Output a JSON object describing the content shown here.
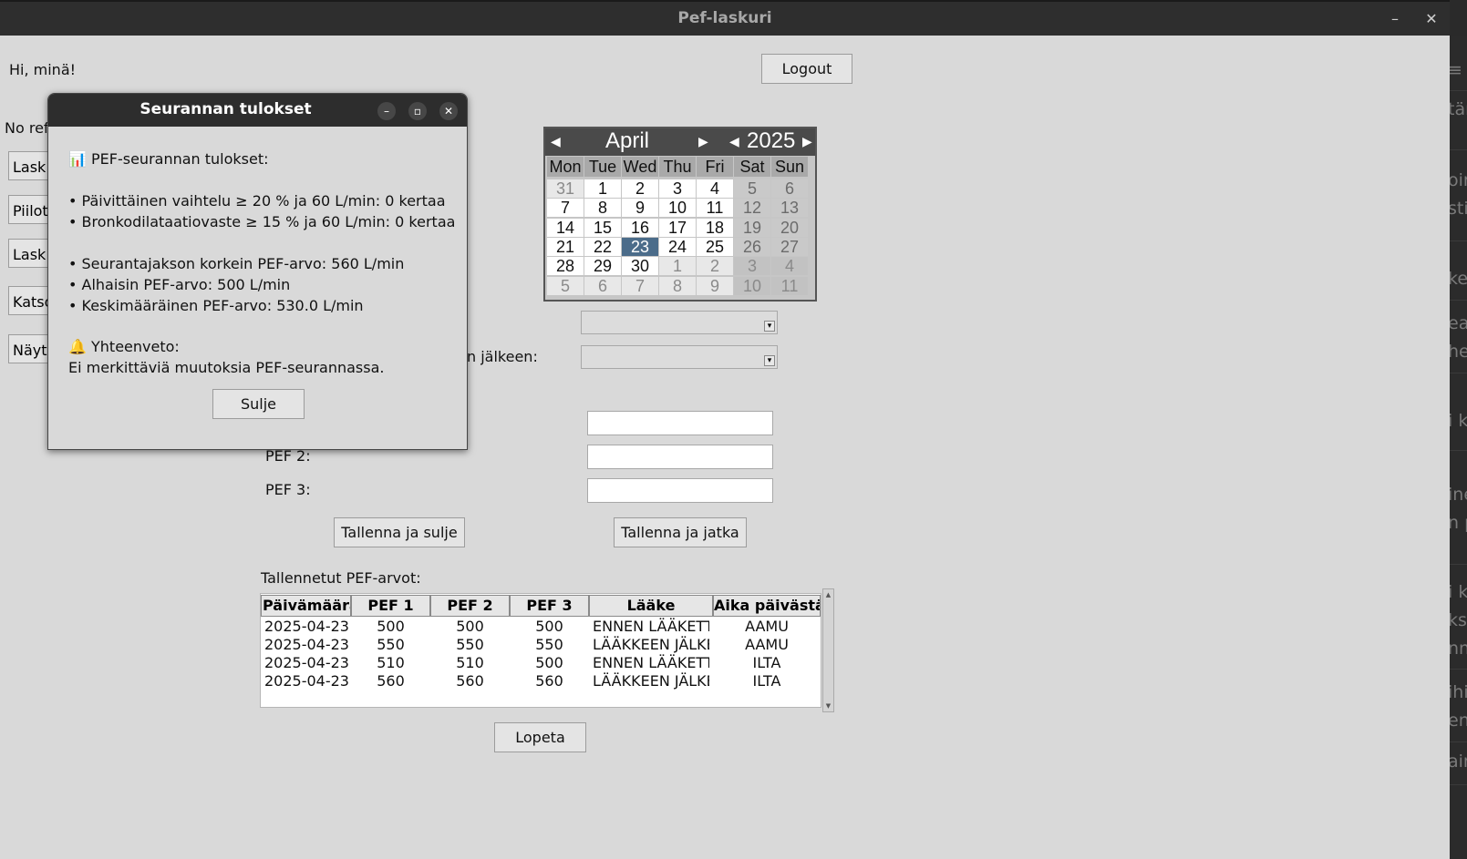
{
  "window": {
    "title": "Pef-laskuri",
    "minimize_glyph": "–",
    "close_glyph": "✕"
  },
  "main": {
    "greeting": "Hi, minä!",
    "logout": "Logout",
    "no_ref": "No ref",
    "side_buttons": [
      "Lask",
      "Piilot",
      "Lask",
      "Katso",
      "Näyt"
    ],
    "after_label": "n jälkeen:",
    "pef2_label": "PEF 2:",
    "pef3_label": "PEF 3:",
    "save_close": "Tallenna ja sulje",
    "save_continue": "Tallenna ja jatka",
    "saved_label": "Tallennetut PEF-arvot:",
    "quit": "Lopeta"
  },
  "calendar": {
    "month": "April",
    "year": "2025",
    "weekdays": [
      "Mon",
      "Tue",
      "Wed",
      "Thu",
      "Fri",
      "Sat",
      "Sun"
    ],
    "weeks": [
      [
        "31",
        "1",
        "2",
        "3",
        "4",
        "5",
        "6"
      ],
      [
        "7",
        "8",
        "9",
        "10",
        "11",
        "12",
        "13"
      ],
      [
        "14",
        "15",
        "16",
        "17",
        "18",
        "19",
        "20"
      ],
      [
        "21",
        "22",
        "23",
        "24",
        "25",
        "26",
        "27"
      ],
      [
        "28",
        "29",
        "30",
        "1",
        "2",
        "3",
        "4"
      ],
      [
        "5",
        "6",
        "7",
        "8",
        "9",
        "10",
        "11"
      ]
    ],
    "selected": "23"
  },
  "table": {
    "headers": [
      "Päivämäärä",
      "PEF 1",
      "PEF 2",
      "PEF 3",
      "Lääke",
      "Aika päivästä"
    ],
    "rows": [
      [
        "2025-04-23",
        "500",
        "500",
        "500",
        "ENNEN LÄÄKETTÄ",
        "AAMU"
      ],
      [
        "2025-04-23",
        "550",
        "550",
        "550",
        "LÄÄKKEEN JÄLKEEN",
        "AAMU"
      ],
      [
        "2025-04-23",
        "510",
        "510",
        "500",
        "ENNEN LÄÄKETTÄ",
        "ILTA"
      ],
      [
        "2025-04-23",
        "560",
        "560",
        "560",
        "LÄÄKKEEN JÄLKEEN",
        "ILTA"
      ]
    ]
  },
  "dialog": {
    "title": "Seurannan tulokset",
    "heading": "📊 PEF-seurannan tulokset:",
    "line1": "• Päivittäinen vaihtelu ≥ 20 % ja 60 L/min: 0 kertaa",
    "line2": "• Bronkodilataatiovaste ≥ 15 % ja 60 L/min: 0 kertaa",
    "line3": "• Seurantajakson korkein PEF-arvo: 560 L/min",
    "line4": "• Alhaisin PEF-arvo: 500 L/min",
    "line5": "• Keskimääräinen PEF-arvo: 530.0 L/min",
    "summary_title": "🔔 Yhteenveto:",
    "summary_text": "Ei merkittäviä muutoksia PEF-seurannassa.",
    "close_button": "Sulje"
  },
  "background_strip": [
    "≡",
    "tär",
    "oir",
    "sti",
    "ker",
    "ea",
    "he",
    "i k",
    "ine",
    "n p",
    "i k",
    "ks",
    "nn",
    "ihi",
    "en",
    "ain"
  ]
}
